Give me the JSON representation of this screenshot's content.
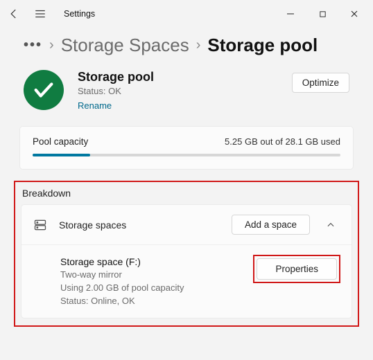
{
  "titlebar": {
    "app": "Settings"
  },
  "breadcrumb": {
    "parent": "Storage Spaces",
    "current": "Storage pool"
  },
  "pool": {
    "title": "Storage pool",
    "status": "Status: OK",
    "rename": "Rename",
    "optimize": "Optimize"
  },
  "capacity": {
    "label": "Pool capacity",
    "used": "5.25 GB out of 28.1 GB used"
  },
  "breakdown": {
    "title": "Breakdown",
    "spaces_label": "Storage spaces",
    "add_space": "Add a space",
    "item": {
      "name": "Storage space (F:)",
      "type": "Two-way mirror",
      "usage": "Using 2.00 GB of pool capacity",
      "status": "Status: Online, OK",
      "properties": "Properties"
    }
  }
}
